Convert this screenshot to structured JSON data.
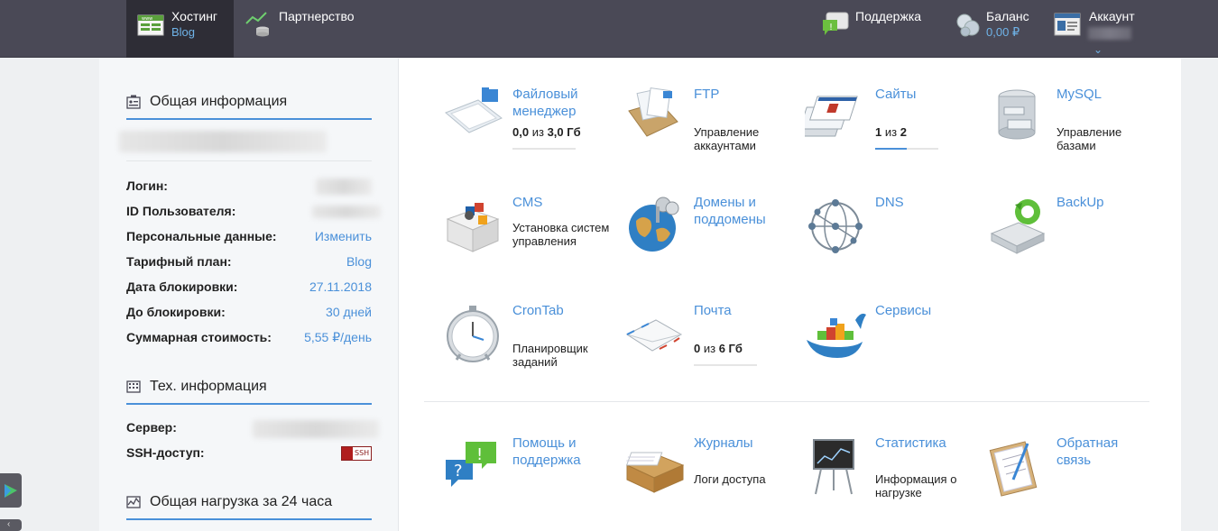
{
  "nav": {
    "hosting": {
      "label": "Хостинг",
      "sub": "Blog"
    },
    "partner": {
      "label": "Партнерство"
    },
    "support": {
      "label": "Поддержка"
    },
    "balance": {
      "label": "Баланс",
      "sub": "0,00 ₽"
    },
    "account": {
      "label": "Аккаунт",
      "chevron": "⌄"
    }
  },
  "sidebar": {
    "general": {
      "title": "Общая информация",
      "rows": [
        {
          "key": "Логин:",
          "value": ""
        },
        {
          "key": "ID Пользователя:",
          "value": ""
        },
        {
          "key": "Персональные данные:",
          "value": "Изменить"
        },
        {
          "key": "Тарифный план:",
          "value": "Blog"
        },
        {
          "key": "Дата блокировки:",
          "value": "27.11.2018"
        },
        {
          "key": "До блокировки:",
          "value": "30 дней"
        },
        {
          "key": "Суммарная стоимость:",
          "value": "5,55 ₽/день"
        }
      ]
    },
    "tech": {
      "title": "Тех. информация",
      "server": "Сервер:",
      "ssh": "SSH-доступ:",
      "ssh_badge": "SSH"
    },
    "load": {
      "title": "Общая нагрузка за 24 часа"
    }
  },
  "tiles": {
    "files": {
      "name": "Файловый менеджер",
      "used": "0,0",
      "of": "из",
      "total": "3,0 Гб",
      "fraction": 0.0
    },
    "ftp": {
      "name": "FTP",
      "desc": "Управление аккаунтами"
    },
    "sites": {
      "name": "Сайты",
      "used": "1",
      "of": "из",
      "total": "2",
      "fraction": 0.5
    },
    "mysql": {
      "name": "MySQL",
      "desc": "Управление базами"
    },
    "cms": {
      "name": "CMS",
      "desc": "Установка систем управления"
    },
    "domains": {
      "name": "Домены и поддомены"
    },
    "dns": {
      "name": "DNS"
    },
    "backup": {
      "name": "BackUp"
    },
    "cron": {
      "name": "CronTab",
      "desc": "Планировщик заданий"
    },
    "mail": {
      "name": "Почта",
      "used": "0",
      "of": "из",
      "total": "6 Гб",
      "fraction": 0.0
    },
    "services": {
      "name": "Сервисы"
    },
    "help": {
      "name": "Помощь и поддержка"
    },
    "logs": {
      "name": "Журналы",
      "desc": "Логи доступа"
    },
    "stats": {
      "name": "Статистика",
      "desc": "Информация о нагрузке"
    },
    "feedback": {
      "name": "Обратная связь"
    }
  },
  "colors": {
    "accent": "#4a90d9",
    "topbar": "#4a4956",
    "active": "#2e2d36"
  }
}
